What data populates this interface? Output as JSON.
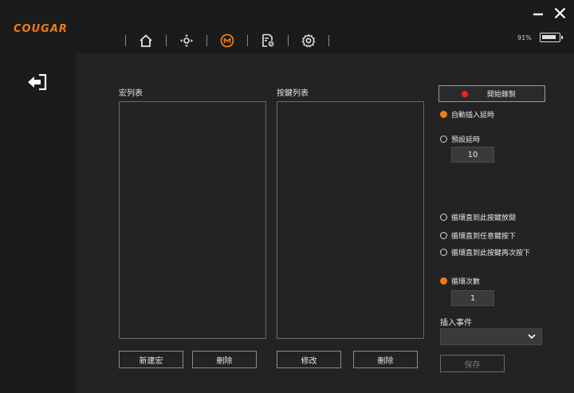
{
  "app": {
    "brand": "COUGAR"
  },
  "nav": {
    "items": [
      {
        "name": "home",
        "icon": "home-icon"
      },
      {
        "name": "buttons",
        "icon": "button-assignment-icon"
      },
      {
        "name": "macro",
        "icon": "macro-icon",
        "active": true
      },
      {
        "name": "profile",
        "icon": "profile-file-icon"
      },
      {
        "name": "settings",
        "icon": "gear-icon"
      }
    ]
  },
  "window": {
    "minimize_icon": "minimize-icon",
    "close_icon": "close-icon"
  },
  "battery": {
    "text": "91%",
    "level": 0.91
  },
  "sidebar": {
    "back_icon": "exit-arrow-icon"
  },
  "macro_list": {
    "title": "宏列表",
    "new_label": "新建宏",
    "delete_label": "刪除"
  },
  "key_list": {
    "title": "按鍵列表",
    "edit_label": "修改",
    "delete_label": "刪除"
  },
  "record": {
    "label": "開始錄製"
  },
  "delay": {
    "auto_label": "自動插入延時",
    "preset_label": "預設延時",
    "preset_value": "10",
    "selected": "auto"
  },
  "loop": {
    "options": [
      "循環直到此按鍵放開",
      "循環直到任意鍵按下",
      "循環直到此按鍵再次按下",
      "循環次數"
    ],
    "selected": 3,
    "count_value": "1"
  },
  "insert_event": {
    "label": "插入事件",
    "value": ""
  },
  "save": {
    "label": "保存"
  },
  "colors": {
    "accent": "#f07a1a",
    "record": "#ff1a1a",
    "background": "#232323",
    "bar": "#1b1b1b"
  }
}
